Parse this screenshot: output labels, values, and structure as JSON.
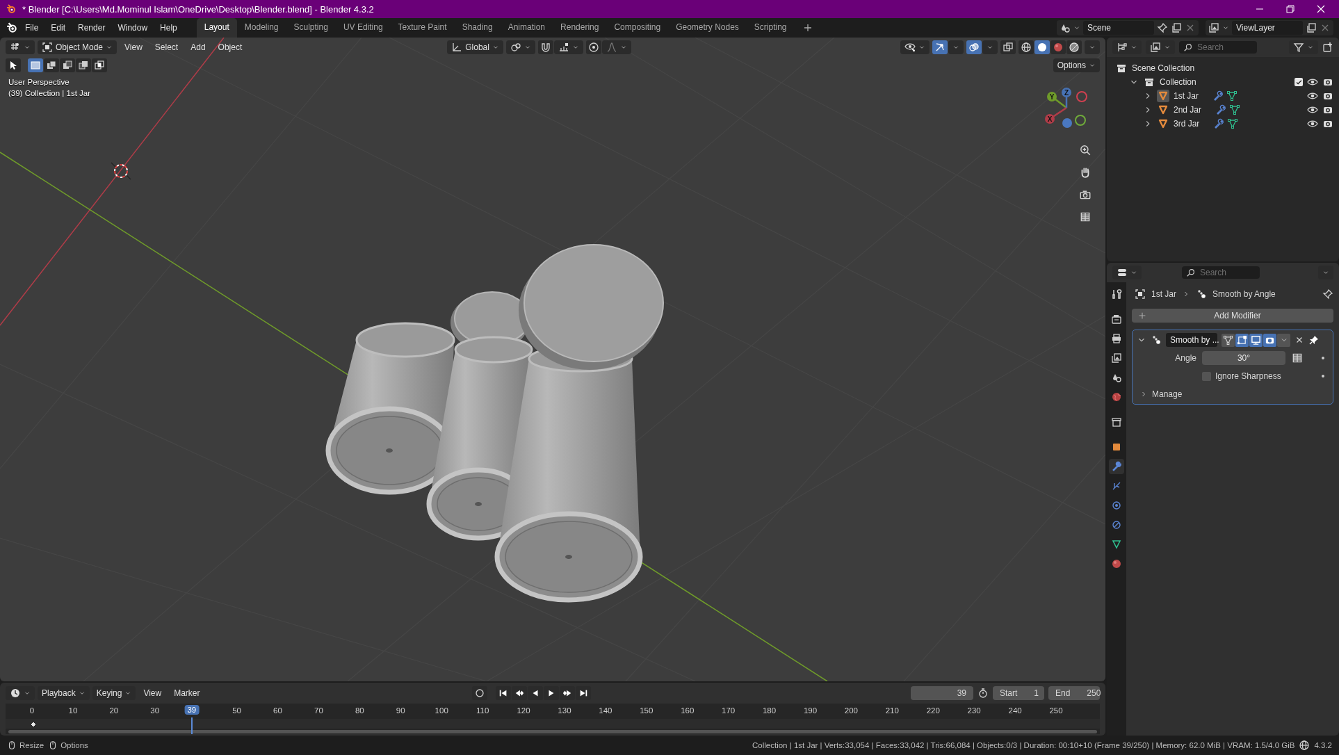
{
  "window": {
    "title": "* Blender [C:\\Users\\Md.Mominul Islam\\OneDrive\\Desktop\\Blender.blend] - Blender 4.3.2"
  },
  "menu": [
    "File",
    "Edit",
    "Render",
    "Window",
    "Help"
  ],
  "workspaces": [
    {
      "label": "Layout",
      "selected": true
    },
    {
      "label": "Modeling",
      "selected": false
    },
    {
      "label": "Sculpting",
      "selected": false
    },
    {
      "label": "UV Editing",
      "selected": false
    },
    {
      "label": "Texture Paint",
      "selected": false
    },
    {
      "label": "Shading",
      "selected": false
    },
    {
      "label": "Animation",
      "selected": false
    },
    {
      "label": "Rendering",
      "selected": false
    },
    {
      "label": "Compositing",
      "selected": false
    },
    {
      "label": "Geometry Nodes",
      "selected": false
    },
    {
      "label": "Scripting",
      "selected": false
    }
  ],
  "scene": {
    "name": "Scene"
  },
  "view_layer": {
    "name": "ViewLayer"
  },
  "viewport": {
    "mode": "Object Mode",
    "menus": [
      "View",
      "Select",
      "Add",
      "Object"
    ],
    "orientation": "Global",
    "select_modes": [
      {
        "selected": true
      },
      {
        "selected": false
      },
      {
        "selected": false
      },
      {
        "selected": false
      },
      {
        "selected": false
      }
    ],
    "shading": [
      {
        "kind": "wireframe",
        "selected": false
      },
      {
        "kind": "solid",
        "selected": true
      },
      {
        "kind": "material",
        "selected": false
      },
      {
        "kind": "rendered",
        "selected": false
      }
    ],
    "options": "Options",
    "info": [
      "User Perspective",
      "(39) Collection | 1st Jar"
    ],
    "gizmo_axes": [
      "Y",
      "Z",
      "X"
    ]
  },
  "outliner": {
    "search": {
      "placeholder": "Search"
    },
    "tree": [
      {
        "label": "Scene Collection",
        "kind": "scene",
        "children": [
          {
            "label": "Collection",
            "kind": "collection",
            "expanded": true,
            "included": true,
            "children": [
              {
                "label": "1st Jar",
                "kind": "mesh",
                "expanded": false,
                "selected": true
              },
              {
                "label": "2nd Jar",
                "kind": "mesh",
                "expanded": false,
                "selected": false
              },
              {
                "label": "3rd Jar",
                "kind": "mesh",
                "expanded": false,
                "selected": false
              }
            ]
          }
        ]
      }
    ]
  },
  "properties": {
    "search": {
      "placeholder": "Search"
    },
    "tabs": [
      {
        "kind": "tool",
        "selected": false
      },
      {
        "kind": "render",
        "selected": false
      },
      {
        "kind": "output",
        "selected": false
      },
      {
        "kind": "view_layer",
        "selected": false
      },
      {
        "kind": "scene",
        "selected": false
      },
      {
        "kind": "world",
        "selected": false
      },
      {
        "kind": "collection",
        "selected": false
      },
      {
        "kind": "object",
        "selected": false
      },
      {
        "kind": "modifiers",
        "selected": true
      },
      {
        "kind": "particles",
        "selected": false
      },
      {
        "kind": "physics",
        "selected": false
      },
      {
        "kind": "constraints",
        "selected": false
      },
      {
        "kind": "data",
        "selected": false
      },
      {
        "kind": "material",
        "selected": false
      }
    ],
    "breadcrumb": [
      "1st Jar",
      "Smooth by Angle"
    ],
    "add_modifier": "Add Modifier",
    "modifier": {
      "name": "Smooth by ...",
      "expanded": true,
      "toggles": [
        {
          "kind": "on_cage",
          "on": false
        },
        {
          "kind": "edit_mode",
          "on": true
        },
        {
          "kind": "viewport",
          "on": true
        },
        {
          "kind": "render",
          "on": true
        }
      ],
      "fields": [
        {
          "kind": "number",
          "label": "Angle",
          "value": "30°"
        },
        {
          "kind": "checkbox",
          "label": "Ignore Sharpness",
          "checked": false
        }
      ],
      "subpanel": {
        "label": "Manage",
        "expanded": false
      }
    }
  },
  "timeline": {
    "menus": [
      {
        "label": "Playback",
        "dropdown": true
      },
      {
        "label": "Keying",
        "dropdown": true
      },
      {
        "label": "View",
        "dropdown": false
      },
      {
        "label": "Marker",
        "dropdown": false
      }
    ],
    "current_frame": "39",
    "start_label": "Start",
    "start": "1",
    "end_label": "End",
    "end": "250",
    "ruler": [
      "0",
      "10",
      "20",
      "30",
      "50",
      "60",
      "70",
      "80",
      "90",
      "100",
      "110",
      "120",
      "130",
      "140",
      "150",
      "160",
      "170",
      "180",
      "190",
      "200",
      "210",
      "220",
      "230",
      "240",
      "250"
    ],
    "playhead": {
      "label": "39",
      "level": 0.156
    }
  },
  "status_bar": {
    "hints": [
      "Resize",
      "Options"
    ],
    "stats": "Collection | 1st Jar | Verts:33,054 | Faces:33,042 | Tris:66,084 | Objects:0/3 | Duration: 00:10+10 (Frame 39/250) | Memory: 62.0 MiB | VRAM: 1.5/4.0 GiB",
    "version": "4.3.2"
  }
}
